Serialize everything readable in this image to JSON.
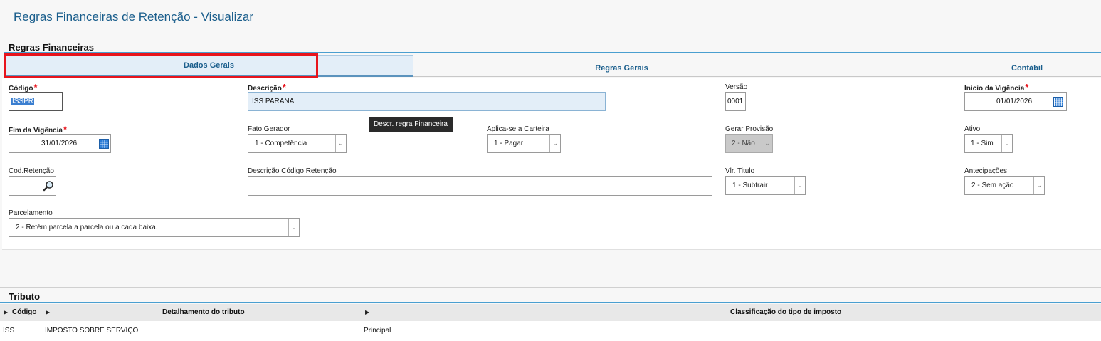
{
  "page": {
    "title": "Regras Financeiras de Retenção - Visualizar"
  },
  "section_regras": {
    "title": "Regras Financeiras"
  },
  "tabs": [
    {
      "label": "Dados Gerais",
      "active": true
    },
    {
      "label": "Regras Gerais",
      "active": false
    },
    {
      "label": "Contábil",
      "active": false
    }
  ],
  "form": {
    "codigo": {
      "label": "Código",
      "value": "ISSPR"
    },
    "descricao": {
      "label": "Descrição",
      "value": "ISS PARANA"
    },
    "versao": {
      "label": "Versão",
      "value": "0001"
    },
    "inicio_vigencia": {
      "label": "Inicio da Vigência",
      "value": "01/01/2026"
    },
    "fim_vigencia": {
      "label": "Fim da Vigência",
      "value": "31/01/2026"
    },
    "fato_gerador": {
      "label": "Fato Gerador",
      "value": "1 - Competência"
    },
    "aplica_carteira": {
      "label": "Aplica-se a Carteira",
      "value": "1 - Pagar"
    },
    "gerar_provisao": {
      "label": "Gerar Provisão",
      "value": "2 - Não"
    },
    "ativo": {
      "label": "Ativo",
      "value": "1 - Sim"
    },
    "cod_retencao": {
      "label": "Cod.Retenção",
      "value": ""
    },
    "desc_cod_retencao": {
      "label": "Descrição Código Retenção",
      "value": ""
    },
    "vlr_titulo": {
      "label": "Vlr. Titulo",
      "value": "1 - Subtrair"
    },
    "antecipacoes": {
      "label": "Antecipações",
      "value": "2 - Sem ação"
    },
    "parcelamento": {
      "label": "Parcelamento",
      "value": "2 -  Retém parcela a parcela ou a cada baixa."
    }
  },
  "tooltip": {
    "text": "Descr. regra Financeira"
  },
  "section_tributo": {
    "title": "Tributo"
  },
  "table": {
    "columns": [
      "Código",
      "Detalhamento do tributo",
      "Classificação do tipo de imposto"
    ],
    "rows": [
      [
        "ISS",
        "IMPOSTO SOBRE SERVIÇO",
        "Principal"
      ]
    ]
  },
  "icons": {
    "calendar": "calendar-icon",
    "search": "search-icon",
    "dropdown": "chevron-down-icon",
    "sort": "sort-triangle-icon"
  },
  "colors": {
    "accent": "#1a5e8c",
    "required": "#e8141c",
    "highlight_box": "#e8141c",
    "active_tab_bg": "#e3eef8"
  }
}
